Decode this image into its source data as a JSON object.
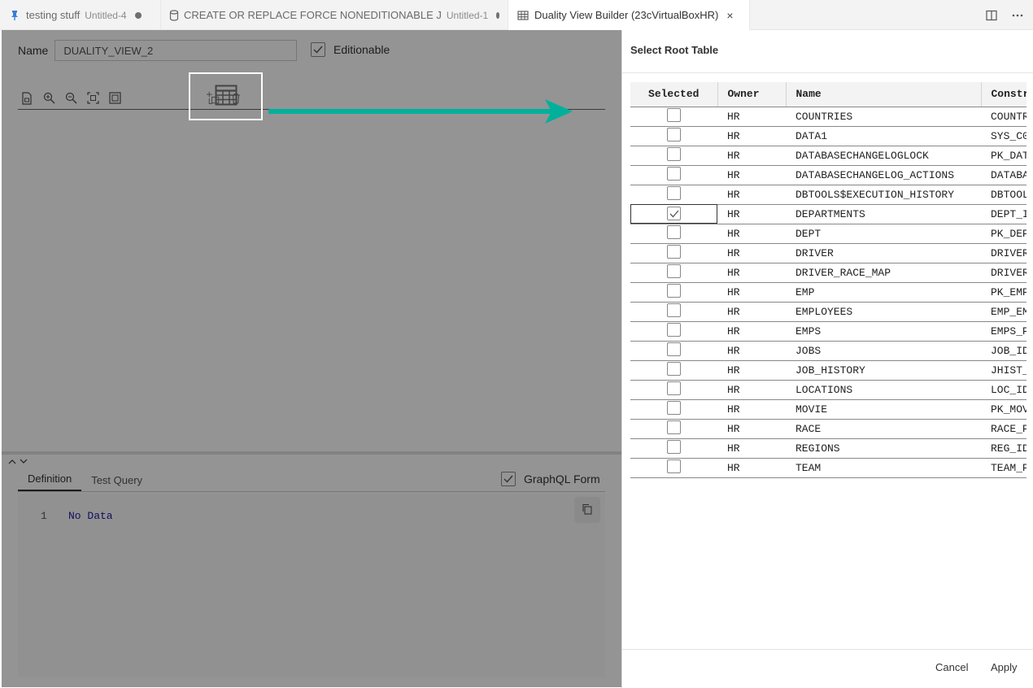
{
  "tabs": [
    {
      "label": "testing stuff",
      "description": "Untitled-4",
      "icon": "pin-icon",
      "dirty": true
    },
    {
      "label": "CREATE OR REPLACE FORCE NONEDITIONABLE J",
      "description": "Untitled-1",
      "icon": "database-icon",
      "dirty": true
    },
    {
      "label": "Duality View Builder (23cVirtualBoxHR)",
      "description": "",
      "icon": "table-grid-icon",
      "active": true
    }
  ],
  "tab_close": "×",
  "editor": {
    "name_label": "Name",
    "name_value": "DUALITY_VIEW_2",
    "editionable_label": "Editionable",
    "editionable_checked": true,
    "toolbar_icons": [
      "new-file-icon",
      "zoom-in-icon",
      "zoom-out-icon",
      "fit-icon",
      "fullscreen-icon",
      "add-table-icon",
      "link-icon",
      "delete-icon"
    ],
    "bottom_tabs": [
      "Definition",
      "Test Query"
    ],
    "graphql_label": "GraphQL Form",
    "graphql_checked": true,
    "code_line_no": "1",
    "code_text": "No Data"
  },
  "panel": {
    "title": "Select Root Table",
    "columns": [
      "Selected",
      "Owner",
      "Name",
      "Constr"
    ],
    "rows": [
      {
        "owner": "HR",
        "name": "COUNTRIES",
        "constraint": "COUNTR",
        "selected": false
      },
      {
        "owner": "HR",
        "name": "DATA1",
        "constraint": "SYS_C0",
        "selected": false
      },
      {
        "owner": "HR",
        "name": "DATABASECHANGELOGLOCK",
        "constraint": "PK_DAT",
        "selected": false
      },
      {
        "owner": "HR",
        "name": "DATABASECHANGELOG_ACTIONS",
        "constraint": "DATABA",
        "selected": false
      },
      {
        "owner": "HR",
        "name": "DBTOOLS$EXECUTION_HISTORY",
        "constraint": "DBTOOL",
        "selected": false
      },
      {
        "owner": "HR",
        "name": "DEPARTMENTS",
        "constraint": "DEPT_I",
        "selected": true
      },
      {
        "owner": "HR",
        "name": "DEPT",
        "constraint": "PK_DEP",
        "selected": false
      },
      {
        "owner": "HR",
        "name": "DRIVER",
        "constraint": "DRIVER",
        "selected": false
      },
      {
        "owner": "HR",
        "name": "DRIVER_RACE_MAP",
        "constraint": "DRIVER",
        "selected": false
      },
      {
        "owner": "HR",
        "name": "EMP",
        "constraint": "PK_EMP",
        "selected": false
      },
      {
        "owner": "HR",
        "name": "EMPLOYEES",
        "constraint": "EMP_EM",
        "selected": false
      },
      {
        "owner": "HR",
        "name": "EMPS",
        "constraint": "EMPS_P",
        "selected": false
      },
      {
        "owner": "HR",
        "name": "JOBS",
        "constraint": "JOB_ID",
        "selected": false
      },
      {
        "owner": "HR",
        "name": "JOB_HISTORY",
        "constraint": "JHIST_",
        "selected": false
      },
      {
        "owner": "HR",
        "name": "LOCATIONS",
        "constraint": "LOC_ID",
        "selected": false
      },
      {
        "owner": "HR",
        "name": "MOVIE",
        "constraint": "PK_MOV",
        "selected": false
      },
      {
        "owner": "HR",
        "name": "RACE",
        "constraint": "RACE_P",
        "selected": false
      },
      {
        "owner": "HR",
        "name": "REGIONS",
        "constraint": "REG_ID",
        "selected": false
      },
      {
        "owner": "HR",
        "name": "TEAM",
        "constraint": "TEAM_P",
        "selected": false
      }
    ],
    "cancel_label": "Cancel",
    "apply_label": "Apply"
  },
  "colors": {
    "annotation_arrow": "#00b09b",
    "annotation_box": "#ffffff",
    "overlay": "#000000"
  }
}
